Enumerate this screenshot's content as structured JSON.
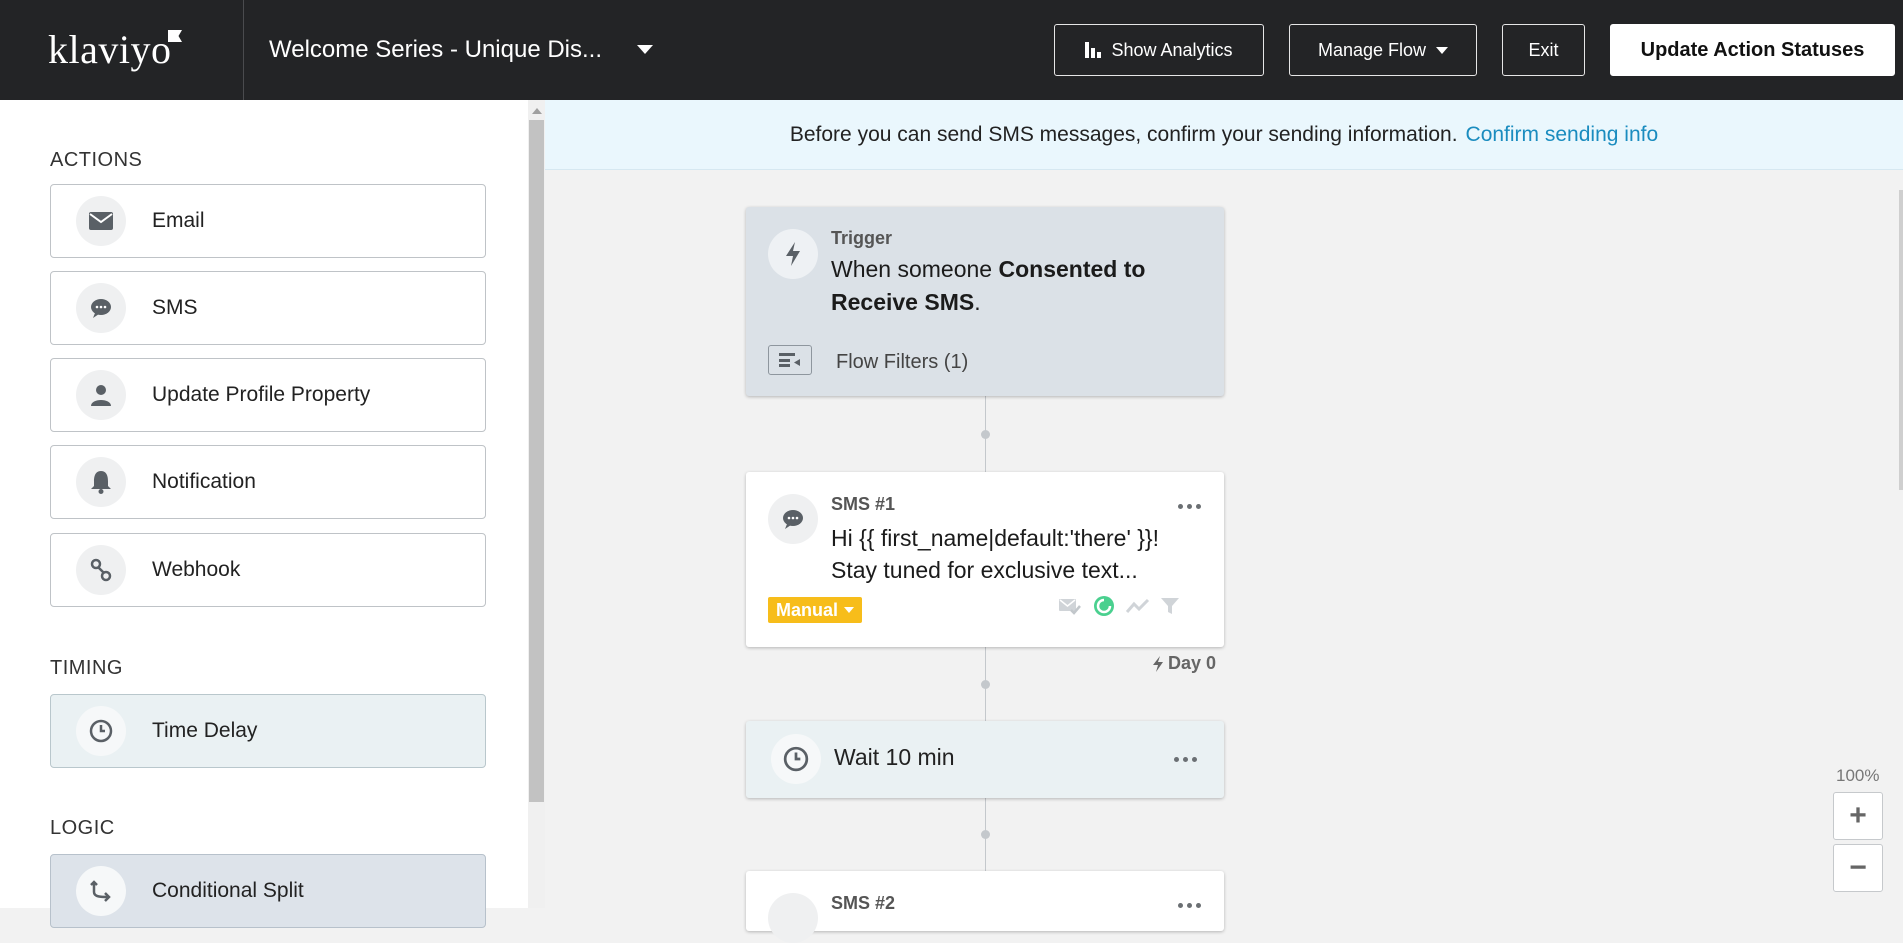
{
  "header": {
    "logo": "klaviyo",
    "flow_name": "Welcome Series - Unique Dis...",
    "show_analytics": "Show Analytics",
    "manage_flow": "Manage Flow",
    "exit": "Exit",
    "update_statuses": "Update Action Statuses"
  },
  "sidebar": {
    "actions_title": "ACTIONS",
    "actions": [
      {
        "label": "Email",
        "icon": "envelope-icon"
      },
      {
        "label": "SMS",
        "icon": "chat-bubble-icon"
      },
      {
        "label": "Update Profile Property",
        "icon": "person-icon"
      },
      {
        "label": "Notification",
        "icon": "bell-icon"
      },
      {
        "label": "Webhook",
        "icon": "webhook-icon"
      }
    ],
    "timing_title": "TIMING",
    "timing": [
      {
        "label": "Time Delay",
        "icon": "clock-icon"
      }
    ],
    "logic_title": "LOGIC",
    "logic": [
      {
        "label": "Conditional Split",
        "icon": "split-arrow-icon"
      }
    ]
  },
  "banner": {
    "text": "Before you can send SMS messages, confirm your sending information.",
    "link": "Confirm sending info"
  },
  "flow": {
    "trigger": {
      "kicker": "Trigger",
      "text_prefix": "When someone ",
      "text_bold": "Consented to Receive SMS",
      "text_suffix": ".",
      "filters": "Flow Filters (1)"
    },
    "sms1": {
      "kicker": "SMS #1",
      "line1": "Hi {{ first_name|default:'there' }}!",
      "line2": "Stay tuned for exclusive text...",
      "status": "Manual",
      "day": "Day 0"
    },
    "wait": {
      "label": "Wait 10 min"
    },
    "sms2": {
      "kicker": "SMS #2"
    }
  },
  "zoom": {
    "level": "100%",
    "plus": "+",
    "minus": "−"
  },
  "colors": {
    "topbar": "#232426",
    "badge": "#f7bd1a",
    "link": "#1a8cbf",
    "banner": "#eaf7fd"
  }
}
